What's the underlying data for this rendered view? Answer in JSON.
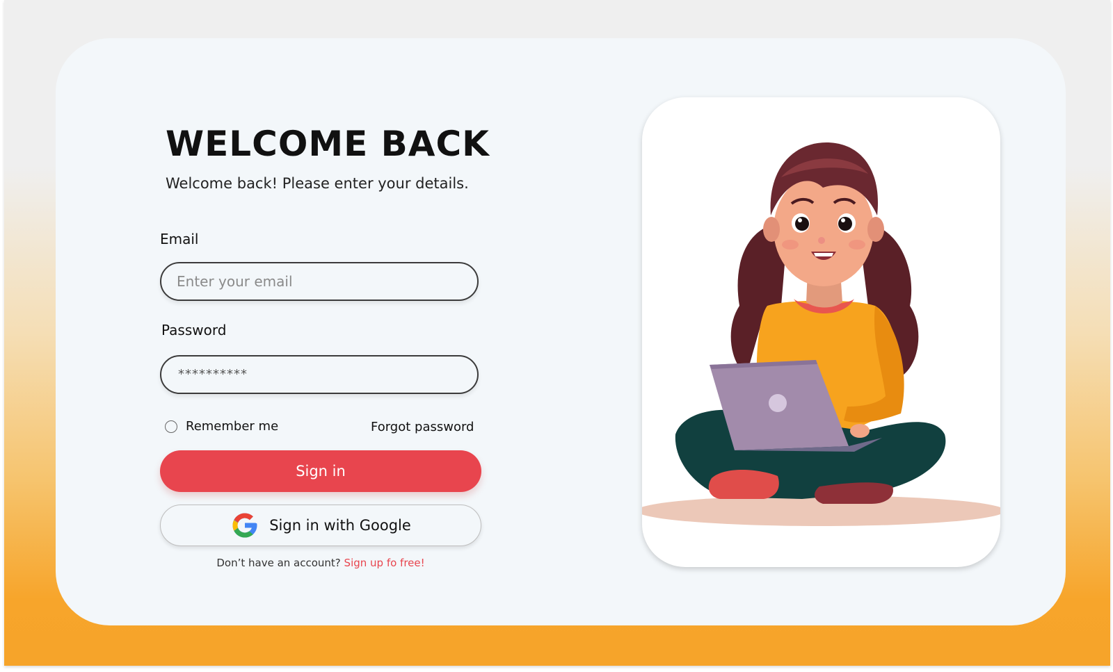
{
  "login": {
    "title": "WELCOME BACK",
    "subtitle": "Welcome back! Please enter your details.",
    "email": {
      "label": "Email",
      "placeholder": "Enter your email"
    },
    "password": {
      "label": "Password",
      "value": "**********"
    },
    "remember_label": "Remember me",
    "forgot_label": "Forgot password",
    "signin_label": "Sign in",
    "google_label": "Sign in with Google",
    "signup_prompt": "Don’t have an account?",
    "signup_link": "Sign up fo free!"
  },
  "icons": {
    "google": "google-icon",
    "radio": "radio-button"
  },
  "illustration": {
    "subject": "woman-sitting-with-laptop"
  },
  "colors": {
    "accent": "#e8454e",
    "card_bg": "#f3f7fa",
    "gradient_bottom": "#f7a52b"
  }
}
